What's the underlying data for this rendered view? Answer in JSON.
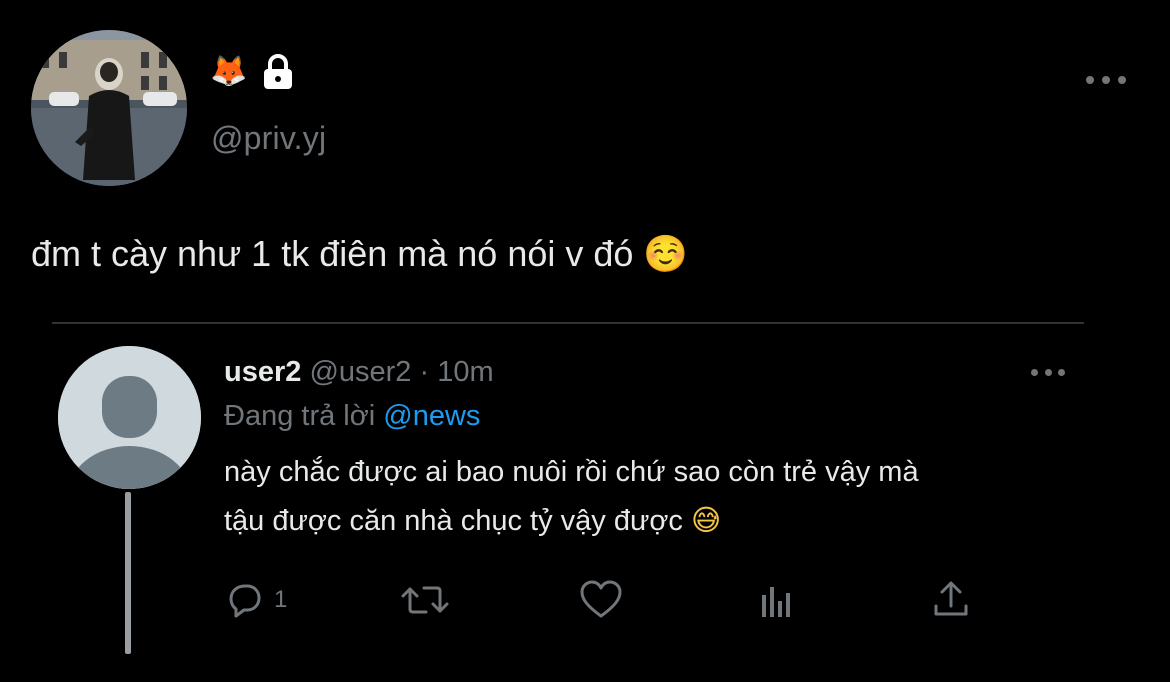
{
  "tweet": {
    "display_name_emoji": "🦊",
    "handle": "@priv.yj",
    "text": "đm t cày như 1 tk điên mà nó nói v đó ",
    "text_emoji": "☺️",
    "icons": {
      "lock": "lock-icon",
      "more": "more-icon"
    }
  },
  "quoted_reply": {
    "name": "user2",
    "handle_time": " @user2 · 10m",
    "replying_label": "Đang trả lời ",
    "replying_mention": "@news",
    "body_line1": "này chắc được ai bao nuôi rồi chứ sao còn trẻ vậy mà",
    "body_line2": "tậu được căn nhà chục tỷ vậy được ",
    "body_emoji": "😅",
    "actions": {
      "reply_count": "1",
      "reply_icon": "reply-icon",
      "retweet_icon": "retweet-icon",
      "like_icon": "heart-icon",
      "views_icon": "analytics-icon",
      "share_icon": "share-icon"
    }
  },
  "colors": {
    "background": "#000000",
    "text": "#e7e9ea",
    "muted": "#71767b",
    "accent": "#1d9bf0",
    "divider": "#2f3336"
  }
}
